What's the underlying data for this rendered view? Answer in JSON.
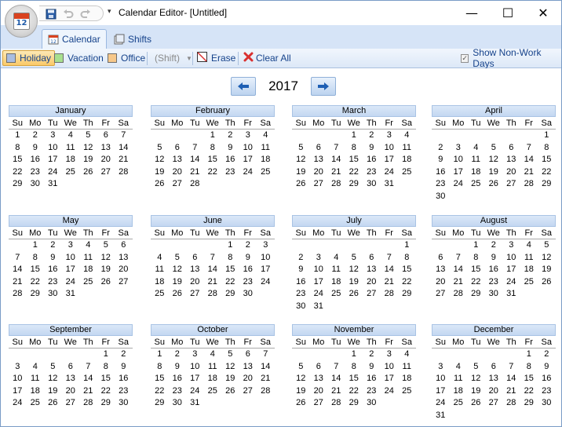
{
  "window": {
    "title": "Calendar Editor- [Untitled]",
    "app_icon_number": "12",
    "controls": {
      "minimize": "—",
      "maximize": "☐",
      "close": "✕"
    }
  },
  "tabs": [
    {
      "label": "Calendar",
      "icon": "calendar-icon",
      "active": true
    },
    {
      "label": "Shifts",
      "icon": "shifts-icon",
      "active": false
    }
  ],
  "toolbar": {
    "holiday": "Holiday",
    "vacation": "Vacation",
    "office": "Office",
    "shift": "(Shift)",
    "erase": "Erase",
    "clear_all": "Clear All",
    "show_nonwork": "Show Non-Work Days",
    "show_nonwork_checked": true
  },
  "colors": {
    "holiday": "#a9bde0",
    "vacation": "#a8e08f",
    "office": "#f7c88a",
    "accent": "#15428b"
  },
  "year": "2017",
  "weekdays": [
    "Su",
    "Mo",
    "Tu",
    "We",
    "Th",
    "Fr",
    "Sa"
  ],
  "months": [
    {
      "name": "January",
      "start": 0,
      "days": 31
    },
    {
      "name": "February",
      "start": 3,
      "days": 28
    },
    {
      "name": "March",
      "start": 3,
      "days": 31
    },
    {
      "name": "April",
      "start": 6,
      "days": 30
    },
    {
      "name": "May",
      "start": 1,
      "days": 31
    },
    {
      "name": "June",
      "start": 4,
      "days": 30
    },
    {
      "name": "July",
      "start": 6,
      "days": 31
    },
    {
      "name": "August",
      "start": 2,
      "days": 31
    },
    {
      "name": "September",
      "start": 5,
      "days": 30
    },
    {
      "name": "October",
      "start": 0,
      "days": 31
    },
    {
      "name": "November",
      "start": 3,
      "days": 30
    },
    {
      "name": "December",
      "start": 5,
      "days": 31
    }
  ]
}
